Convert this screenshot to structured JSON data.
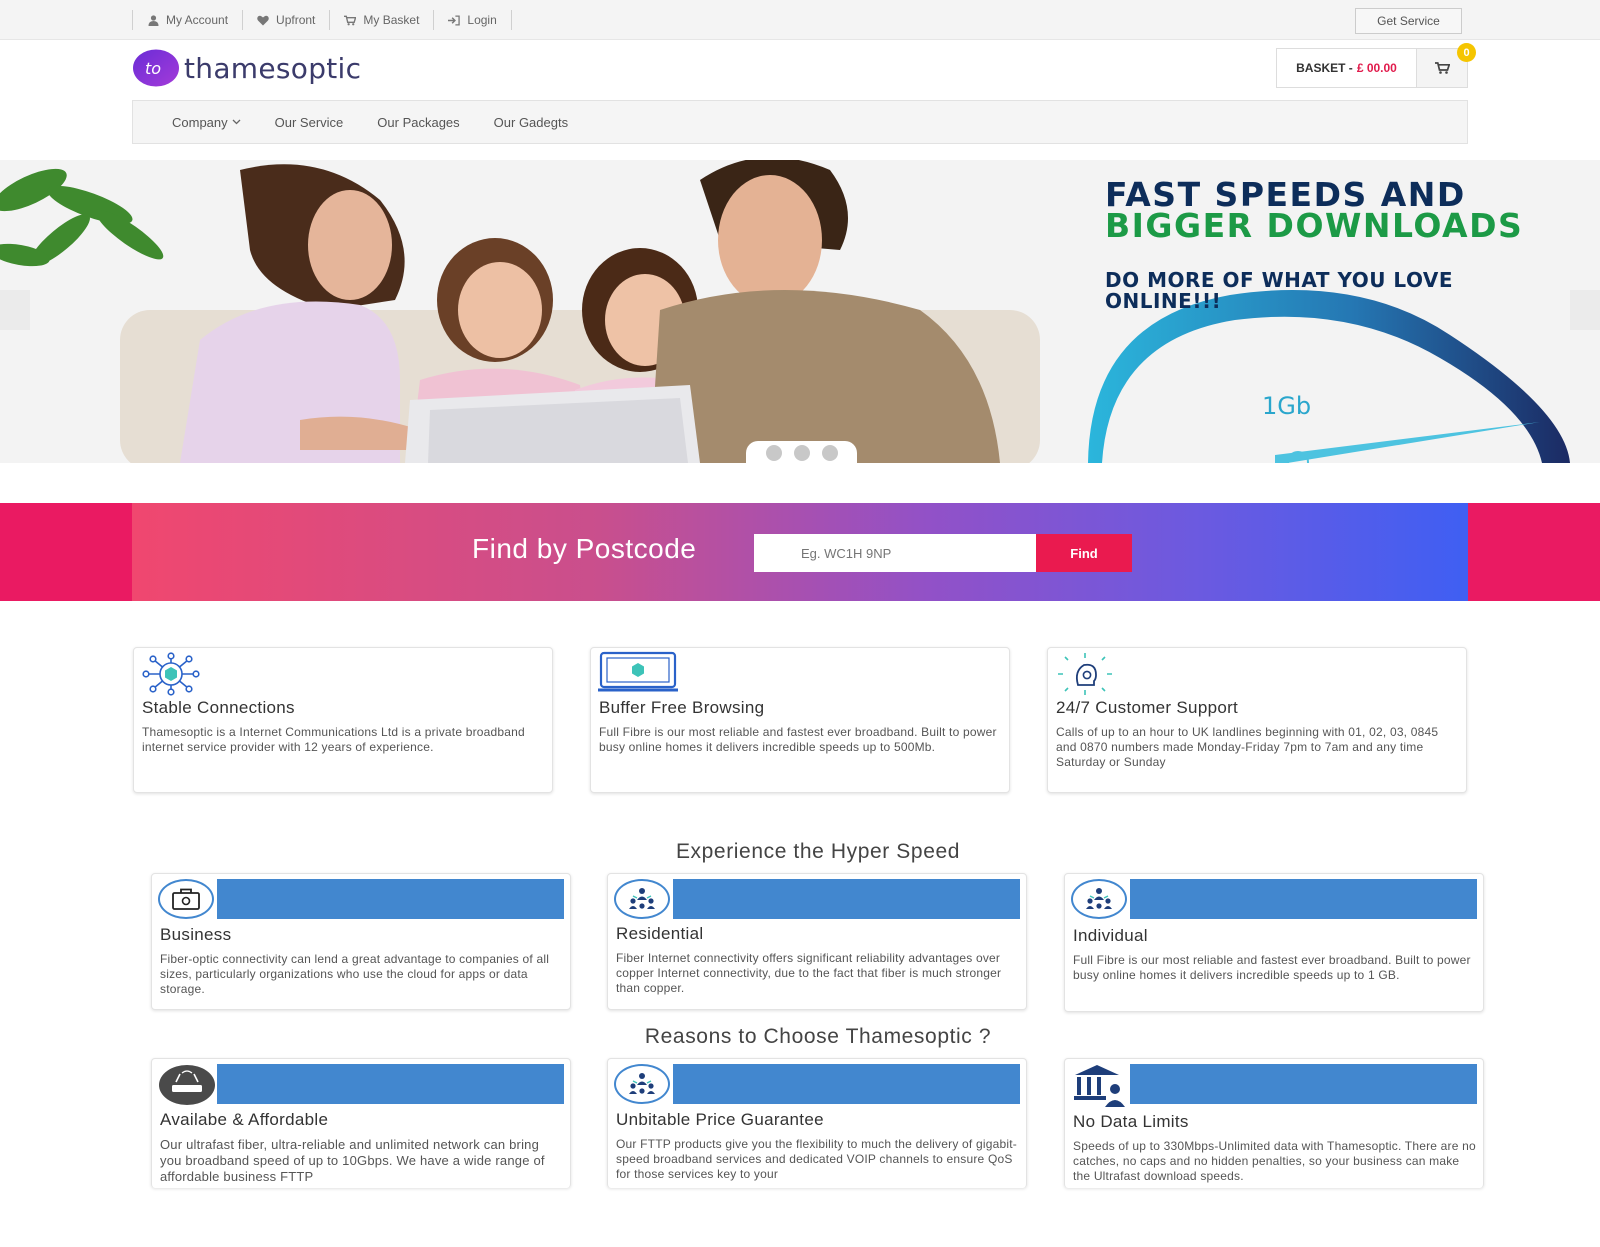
{
  "topbar": {
    "links": [
      {
        "label": "My Account",
        "icon": "user-icon"
      },
      {
        "label": "Upfront",
        "icon": "heart-icon"
      },
      {
        "label": "My Basket",
        "icon": "cart-icon"
      },
      {
        "label": "Login",
        "icon": "login-icon"
      }
    ],
    "get_service": "Get Service"
  },
  "header": {
    "logo_text": "thamesoptic",
    "logo_mark": "to",
    "basket_label": "BASKET -",
    "basket_amount": "£ 00.00",
    "basket_count": "0"
  },
  "nav": {
    "items": [
      "Company",
      "Our Service",
      "Our Packages",
      "Our Gadegts"
    ]
  },
  "hero": {
    "headline_line1": "FAST SPEEDS AND",
    "headline_line2": "BIGGER DOWNLOADS",
    "subline": "DO MORE OF WHAT YOU LOVE ONLINE!!!",
    "speed": "1Gb"
  },
  "postcode": {
    "title": "Find by Postcode",
    "placeholder": "Eg. WC1H 9NP",
    "button": "Find"
  },
  "features": [
    {
      "title": "Stable Connections",
      "text": "Thamesoptic is a Internet Communications Ltd is a private broadband internet service provider with 12 years of experience.",
      "icon": "network-cube-icon"
    },
    {
      "title": "Buffer Free Browsing",
      "text": "Full Fibre is our most reliable and fastest ever broadband. Built to power busy online homes it delivers incredible speeds up to 500Mb.",
      "icon": "laptop-cube-icon"
    },
    {
      "title": "24/7 Customer Support",
      "text": "Calls of up to an hour to UK landlines beginning with 01, 02, 03, 0845 and 0870 numbers made Monday-Friday 7pm to 7am and any time Saturday or Sunday",
      "icon": "support-head-icon"
    }
  ],
  "hyper": {
    "title": "Experience the Hyper Speed",
    "cards": [
      {
        "title": "Business",
        "text": "Fiber-optic connectivity can lend a great advantage to companies of all sizes, particularly organizations who use the cloud for apps or data storage.",
        "icon": "briefcase-icon"
      },
      {
        "title": "Residential",
        "text": "Fiber Internet connectivity offers significant reliability advantages over copper Internet connectivity, due to the fact that fiber is much stronger than copper.",
        "icon": "group-network-icon"
      },
      {
        "title": "Individual",
        "text": "Full Fibre is our most reliable and fastest ever broadband. Built to power busy online homes it delivers incredible speeds up to 1 GB.",
        "icon": "group-network-icon"
      }
    ]
  },
  "reasons": {
    "title": "Reasons to Choose Thamesoptic ?",
    "cards": [
      {
        "title": "Availabe & Affordable",
        "text": "Our ultrafast fiber, ultra-reliable and unlimited network can bring you broadband speed of up to 10Gbps. We have a wide range of affordable business FTTP",
        "icon": "router-icon"
      },
      {
        "title": "Unbitable Price Guarantee",
        "text": "Our FTTP products give you the flexibility to much the delivery of gigabit-speed broadband services and dedicated VOIP channels to ensure QoS for those services key to your",
        "icon": "group-network-icon"
      },
      {
        "title": "No Data Limits",
        "text": "Speeds of up to 330Mbps-Unlimited data with Thamesoptic. There are no catches, no caps and no hidden penalties, so your business can make the Ultrafast download speeds.",
        "icon": "bank-user-icon"
      }
    ]
  },
  "colors": {
    "accent_pink": "#ea1a4f",
    "blue_bar": "#4287cf",
    "headline_navy": "#0d2d5a",
    "headline_green": "#1c9a46"
  }
}
